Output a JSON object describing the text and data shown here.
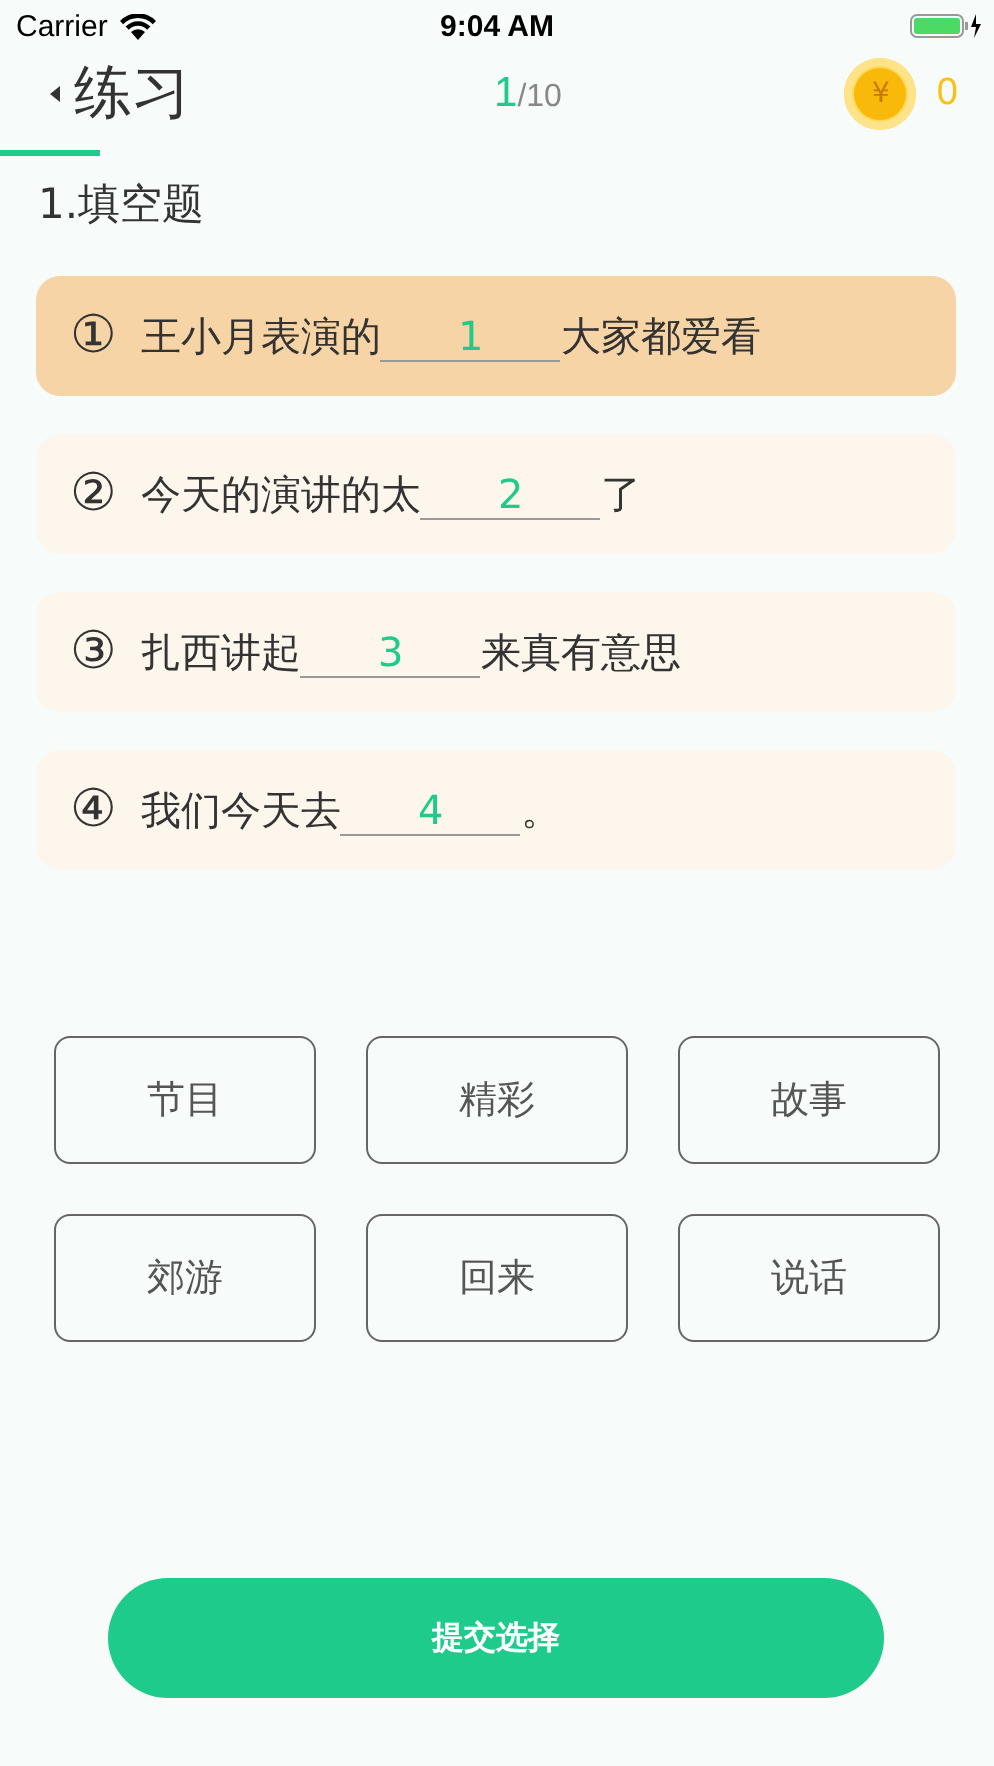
{
  "status_bar": {
    "carrier": "Carrier",
    "time": "9:04 AM"
  },
  "nav": {
    "title": "练习",
    "progress_current": "1",
    "progress_total": "/10",
    "coins": "0",
    "coin_symbol": "¥"
  },
  "section_title": "1.填空题",
  "questions": [
    {
      "marker": "①",
      "before": "王小月表演的",
      "blank": "1",
      "after": "大家都爱看",
      "selected": true
    },
    {
      "marker": "②",
      "before": "今天的演讲的太",
      "blank": "2",
      "after": "了",
      "selected": false
    },
    {
      "marker": "③",
      "before": "扎西讲起",
      "blank": "3",
      "after": "来真有意思",
      "selected": false
    },
    {
      "marker": "④",
      "before": "我们今天去",
      "blank": "4",
      "after": "。",
      "selected": false
    }
  ],
  "words": [
    "节目",
    "精彩",
    "故事",
    "郊游",
    "回来",
    "说话"
  ],
  "submit": "提交选择"
}
